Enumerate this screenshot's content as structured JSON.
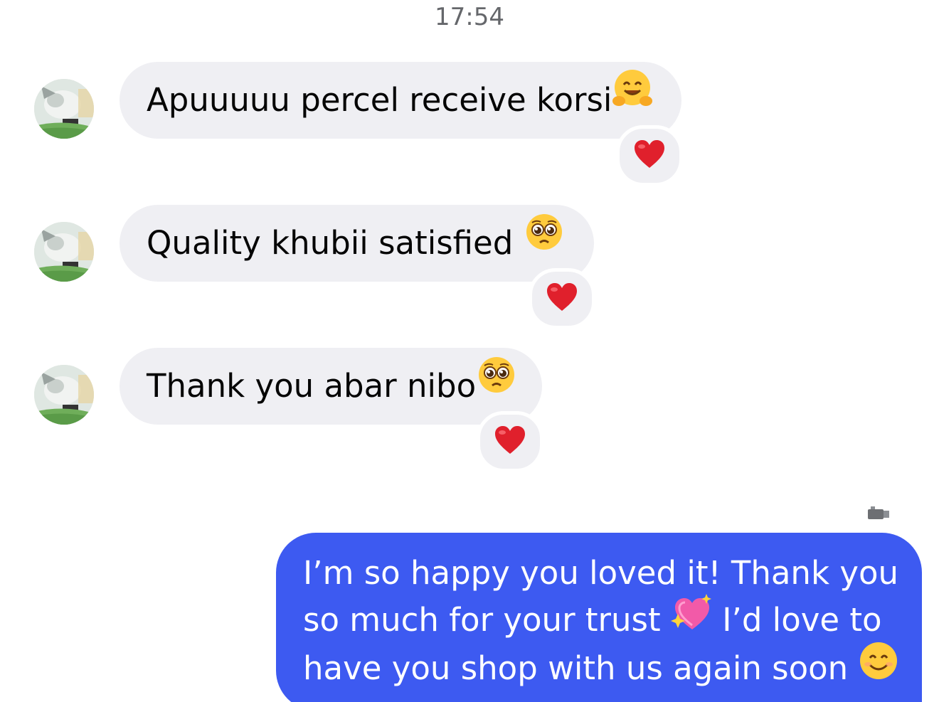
{
  "conversation": {
    "timestamp": "17:54",
    "incoming": [
      {
        "text": "Apuuuuu percel receive korsi",
        "emoji": "hugging-face-emoji",
        "reaction": "❤️"
      },
      {
        "text": "Quality khubii satisfied ",
        "emoji": "pleading-face-emoji",
        "reaction": "❤️"
      },
      {
        "text": "Thank you abar nibo",
        "emoji": "pleading-face-emoji",
        "reaction": "❤️"
      }
    ],
    "outgoing": {
      "line1": "I’m so happy you loved it! Thank you",
      "line2_a": "so much for your trust ",
      "line2_b": " I’d love to",
      "line3": "have you shop with us again soon ",
      "emojis": [
        "sparkling-heart-emoji",
        "smiling-face-emoji"
      ]
    }
  },
  "colors": {
    "incoming_bubble": "#efeff3",
    "outgoing_bubble": "#3d5af1",
    "timestamp_text": "#65676b",
    "reaction_heart": "#e0202c"
  }
}
